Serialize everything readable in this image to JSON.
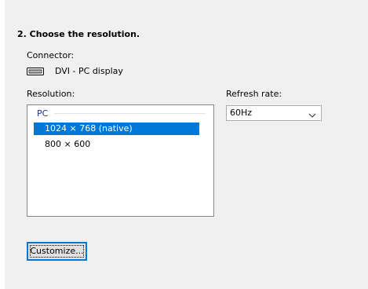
{
  "section_title": "2. Choose the resolution.",
  "connector": {
    "label": "Connector:",
    "value": "DVI - PC display",
    "icon": "dvi-connector-icon"
  },
  "resolution": {
    "label": "Resolution:",
    "group_header": "PC",
    "items": [
      {
        "label": "1024 × 768 (native)",
        "selected": true
      },
      {
        "label": "800 × 600",
        "selected": false
      }
    ]
  },
  "refresh_rate": {
    "label": "Refresh rate:",
    "selected_value": "60Hz"
  },
  "customize_button_label": "Customize...",
  "colors": {
    "accent": "#0078d7",
    "background": "#f0f0f0",
    "group_header": "#1e3287"
  }
}
